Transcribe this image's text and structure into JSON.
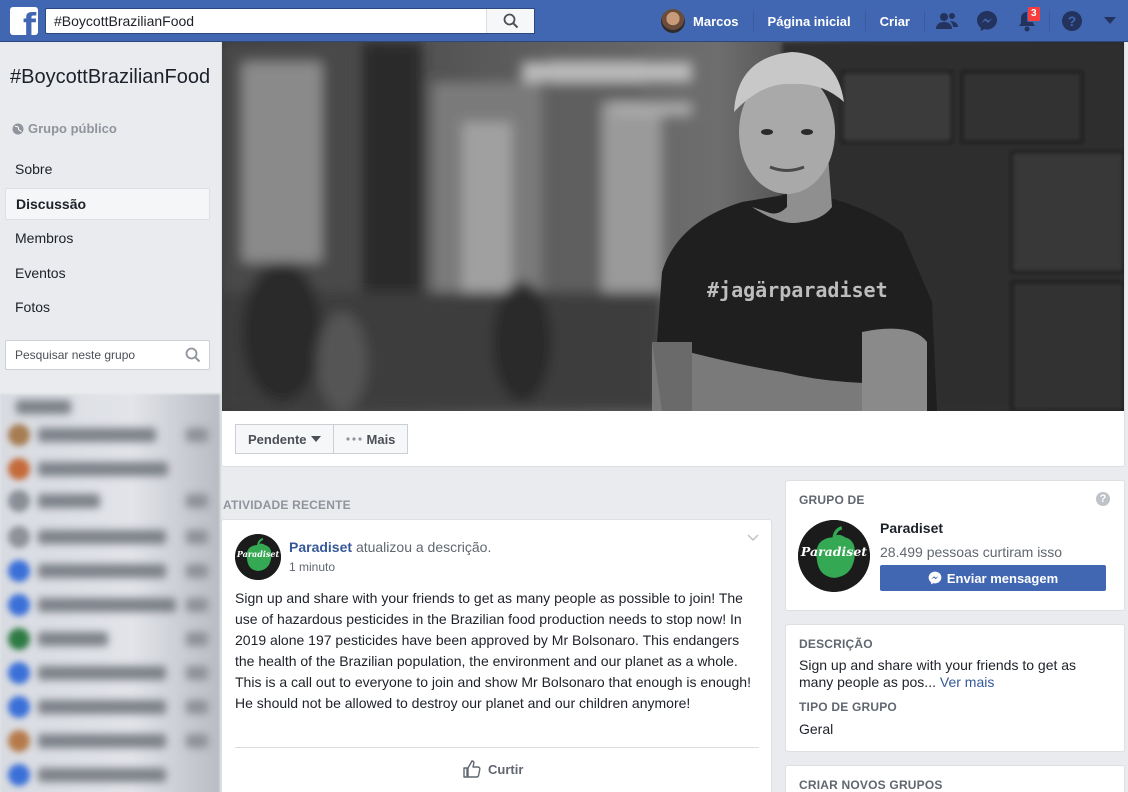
{
  "topbar": {
    "search_value": "#BoycottBrazilianFood",
    "user_name": "Marcos",
    "home_label": "Página inicial",
    "create_label": "Criar",
    "notifications_count": "3",
    "icons": [
      "facebook-logo-icon",
      "search-icon",
      "friends-icon",
      "messenger-icon",
      "notifications-icon",
      "help-icon",
      "caret-down-icon"
    ],
    "brand_color": "#4267b2"
  },
  "group": {
    "title": "#BoycottBrazilianFood",
    "privacy": "Grupo público",
    "nav": [
      {
        "label": "Sobre",
        "active": false
      },
      {
        "label": "Discussão",
        "active": true
      },
      {
        "label": "Membros",
        "active": false
      },
      {
        "label": "Eventos",
        "active": false
      },
      {
        "label": "Fotos",
        "active": false
      }
    ],
    "search_placeholder": "Pesquisar neste grupo"
  },
  "cover": {
    "shirt_text": "#jagärparadiset",
    "pending_label": "Pendente",
    "more_label": "Mais"
  },
  "activity": {
    "section_label": "ATIVIDADE RECENTE",
    "post": {
      "author": "Paradiset",
      "action": "atualizou a descrição.",
      "time": "1 minuto",
      "avatar_logo": "Paradiset",
      "body": "Sign up and share with your friends to get as many people as possible to join! The use of hazardous pesticides in the Brazilian food production needs to stop now! In 2019 alone 197 pesticides have been approved by Mr Bolsonaro. This endangers the health of the Brazilian population, the environment and our planet as a whole. This is a call out to everyone to join and show Mr Bolsonaro that enough is enough! He should not be allowed to destroy our planet and our children anymore!",
      "like_label": "Curtir"
    }
  },
  "sidebar": {
    "group_of_label": "GRUPO DE",
    "help_glyph": "?",
    "page_name": "Paradiset",
    "page_likes": "28.499 pessoas curtiram isso",
    "message_button": "Enviar mensagem",
    "description_label": "DESCRIÇÃO",
    "description_text": "Sign up and share with your friends to get as many people as pos...",
    "see_more": "Ver mais",
    "group_type_label": "TIPO DE GRUPO",
    "group_type_value": "Geral",
    "create_groups_label": "CRIAR NOVOS GRUPOS"
  }
}
